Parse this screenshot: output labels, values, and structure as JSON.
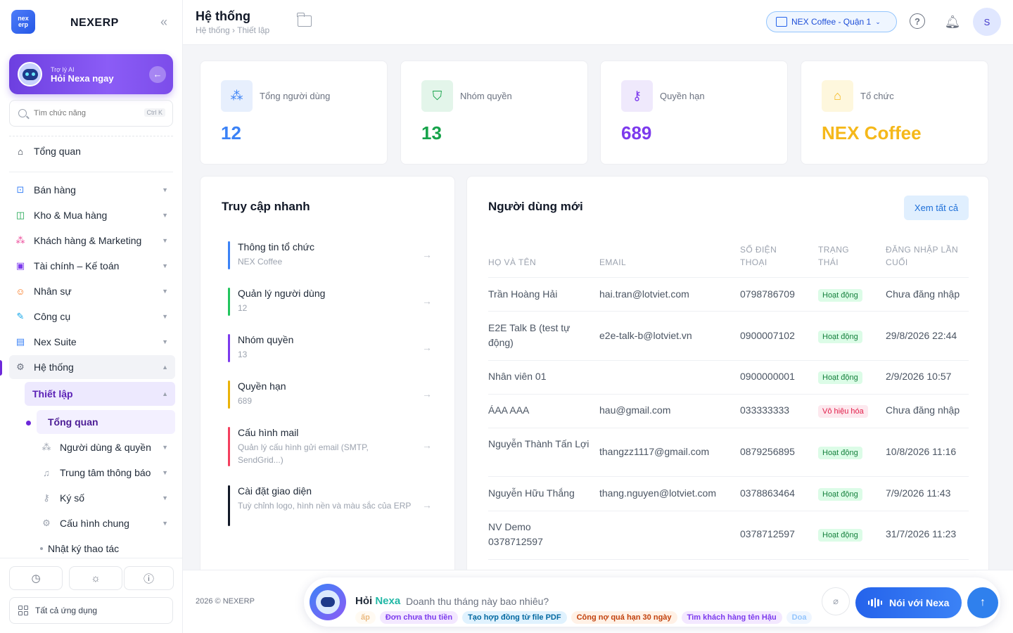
{
  "brand": {
    "logo_top": "nex",
    "logo_bottom": "erp",
    "name": "NEXERP",
    "collapse_icon": "«"
  },
  "ai": {
    "small": "Trợ lý AI",
    "big": "Hỏi Nexa ngay"
  },
  "search": {
    "placeholder": "Tìm chức năng",
    "shortcut": "Ctrl K"
  },
  "nav": {
    "overview": "Tổng quan",
    "items": [
      {
        "label": "Bán hàng",
        "icon": "cart-icon"
      },
      {
        "label": "Kho & Mua hàng",
        "icon": "bag-icon"
      },
      {
        "label": "Khách hàng & Marketing",
        "icon": "users-icon"
      },
      {
        "label": "Tài chính – Kế toán",
        "icon": "calculator-icon"
      },
      {
        "label": "Nhân sự",
        "icon": "person-icon"
      },
      {
        "label": "Công cụ",
        "icon": "wrench-icon"
      },
      {
        "label": "Nex Suite",
        "icon": "document-icon"
      },
      {
        "label": "Hệ thống",
        "icon": "gear-icon"
      }
    ],
    "sub": "Thiết lập",
    "subsub": "Tổng quan",
    "level2": [
      {
        "label": "Người dùng & quyền"
      },
      {
        "label": "Trung tâm thông báo"
      },
      {
        "label": "Ký số"
      },
      {
        "label": "Cấu hình chung"
      }
    ],
    "log": "Nhật ký thao tác"
  },
  "all_apps": "Tất cả ứng dụng",
  "header": {
    "title": "Hệ thống",
    "breadcrumb": "Hệ thống › Thiết lập",
    "branch": "NEX Coffee - Quận 1",
    "avatar": "S"
  },
  "stats": [
    {
      "label": "Tổng người dùng",
      "value": "12",
      "color": "#3b82f6",
      "bg": "#e7effd"
    },
    {
      "label": "Nhóm quyền",
      "value": "13",
      "color": "#16a34a",
      "bg": "#e3f5ea"
    },
    {
      "label": "Quyền hạn",
      "value": "689",
      "color": "#7c3aed",
      "bg": "#efe9fc"
    },
    {
      "label": "Tổ chức",
      "value": "NEX Coffee",
      "color": "#f5b81a",
      "bg": "#fef7dd"
    }
  ],
  "quick": {
    "title": "Truy cập nhanh",
    "items": [
      {
        "title": "Thông tin tổ chức",
        "desc": "NEX Coffee",
        "color": "#3b82f6"
      },
      {
        "title": "Quản lý người dùng",
        "desc": "12",
        "color": "#22c55e"
      },
      {
        "title": "Nhóm quyền",
        "desc": "13",
        "color": "#7c3aed"
      },
      {
        "title": "Quyền hạn",
        "desc": "689",
        "color": "#eab308"
      },
      {
        "title": "Cấu hình mail",
        "desc": "Quản lý cấu hình gửi email (SMTP, SendGrid...)",
        "color": "#f43f5e"
      },
      {
        "title": "Cài đặt giao diện",
        "desc": "Tuỳ chỉnh logo, hình nền và màu sắc của ERP",
        "color": "#111827"
      }
    ]
  },
  "users": {
    "title": "Người dùng mới",
    "view_all": "Xem tất cả",
    "headers": [
      "Họ và tên",
      "Email",
      "Số điện thoại",
      "Trạng thái",
      "Đăng nhập lần cuối"
    ],
    "rows": [
      {
        "name": "Trần Hoàng Hải",
        "email": "hai.tran@lotviet.com",
        "phone": "0798786709",
        "status": "Hoạt động",
        "active": true,
        "last": "Chưa đăng nhập"
      },
      {
        "name": "E2E Talk B (test tự động)",
        "email": "e2e-talk-b@lotviet.vn",
        "phone": "0900007102",
        "status": "Hoạt động",
        "active": true,
        "last": "29/8/2026 22:44"
      },
      {
        "name": "Nhân viên 01",
        "email": "",
        "phone": "0900000001",
        "status": "Hoạt động",
        "active": true,
        "last": "2/9/2026 10:57"
      },
      {
        "name": "ÁAA AAA",
        "email": "hau@gmail.com",
        "phone": "033333333",
        "status": "Vô hiệu hóa",
        "active": false,
        "last": "Chưa đăng nhập"
      },
      {
        "name": "Nguyễn Thành Tấn Lợi",
        "email": "thangzz1117@gmail.com",
        "phone": "0879256895",
        "status": "Hoạt động",
        "active": true,
        "last": "10/8/2026 11:16"
      },
      {
        "name": "Nguyễn Hữu Thắng",
        "email": "thang.nguyen@lotviet.com",
        "phone": "0378863464",
        "status": "Hoạt động",
        "active": true,
        "last": "7/9/2026 11:43"
      },
      {
        "name": "NV Demo 0378712597",
        "email": "",
        "phone": "0378712597",
        "status": "Hoạt động",
        "active": true,
        "last": "31/7/2026 11:23"
      }
    ]
  },
  "footer": {
    "copy": "2026 © NEXERP",
    "hoi": "Hỏi",
    "nexa": "Nexa",
    "question": "Doanh thu tháng này bao nhiêu?",
    "chips": [
      {
        "label": "ấp",
        "color": "#d97706",
        "bg": "#fff7e6"
      },
      {
        "label": "Đơn chưa thu tiền",
        "color": "#7c3aed",
        "bg": "#f3e8ff"
      },
      {
        "label": "Tạo hợp đồng từ file PDF",
        "color": "#0369a1",
        "bg": "#e0f2fe"
      },
      {
        "label": "Công nợ quá hạn 30 ngày",
        "color": "#c2410c",
        "bg": "#fff1e6"
      },
      {
        "label": "Tìm khách hàng tên Hậu",
        "color": "#7c3aed",
        "bg": "#f3e8ff"
      },
      {
        "label": "Doa",
        "color": "#93c5fd",
        "bg": "#eff6ff"
      }
    ],
    "talk": "Nói với Nexa"
  }
}
